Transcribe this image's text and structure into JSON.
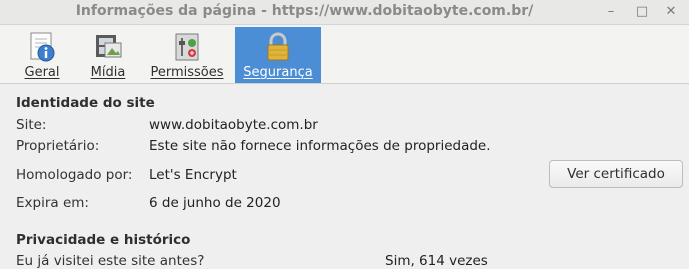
{
  "window": {
    "title": "Informações da página - https://www.dobitaobyte.com.br/",
    "minimize_glyph": "–",
    "maximize_glyph": "□",
    "close_glyph": "✕"
  },
  "tabs": [
    {
      "label": "Geral",
      "icon": "info-document-icon",
      "active": false
    },
    {
      "label": "Mídia",
      "icon": "media-film-icon",
      "active": false
    },
    {
      "label": "Permissões",
      "icon": "permissions-settings-icon",
      "active": false
    },
    {
      "label": "Segurança",
      "icon": "lock-icon",
      "active": true
    }
  ],
  "identity": {
    "heading": "Identidade do site",
    "site_label": "Site:",
    "site_value": "www.dobitaobyte.com.br",
    "owner_label": "Proprietário:",
    "owner_value": "Este site não fornece informações de propriedade.",
    "verified_label": "Homologado por:",
    "verified_value": "Let's Encrypt",
    "expires_label": "Expira em:",
    "expires_value": "6 de junho de 2020",
    "cert_button": "Ver certificado"
  },
  "privacy": {
    "heading": "Privacidade e histórico",
    "visited_label": "Eu já visitei este site antes?",
    "visited_value": "Sim, 614 vezes"
  },
  "colors": {
    "active_tab": "#4b8ed5",
    "background": "#efefef"
  }
}
